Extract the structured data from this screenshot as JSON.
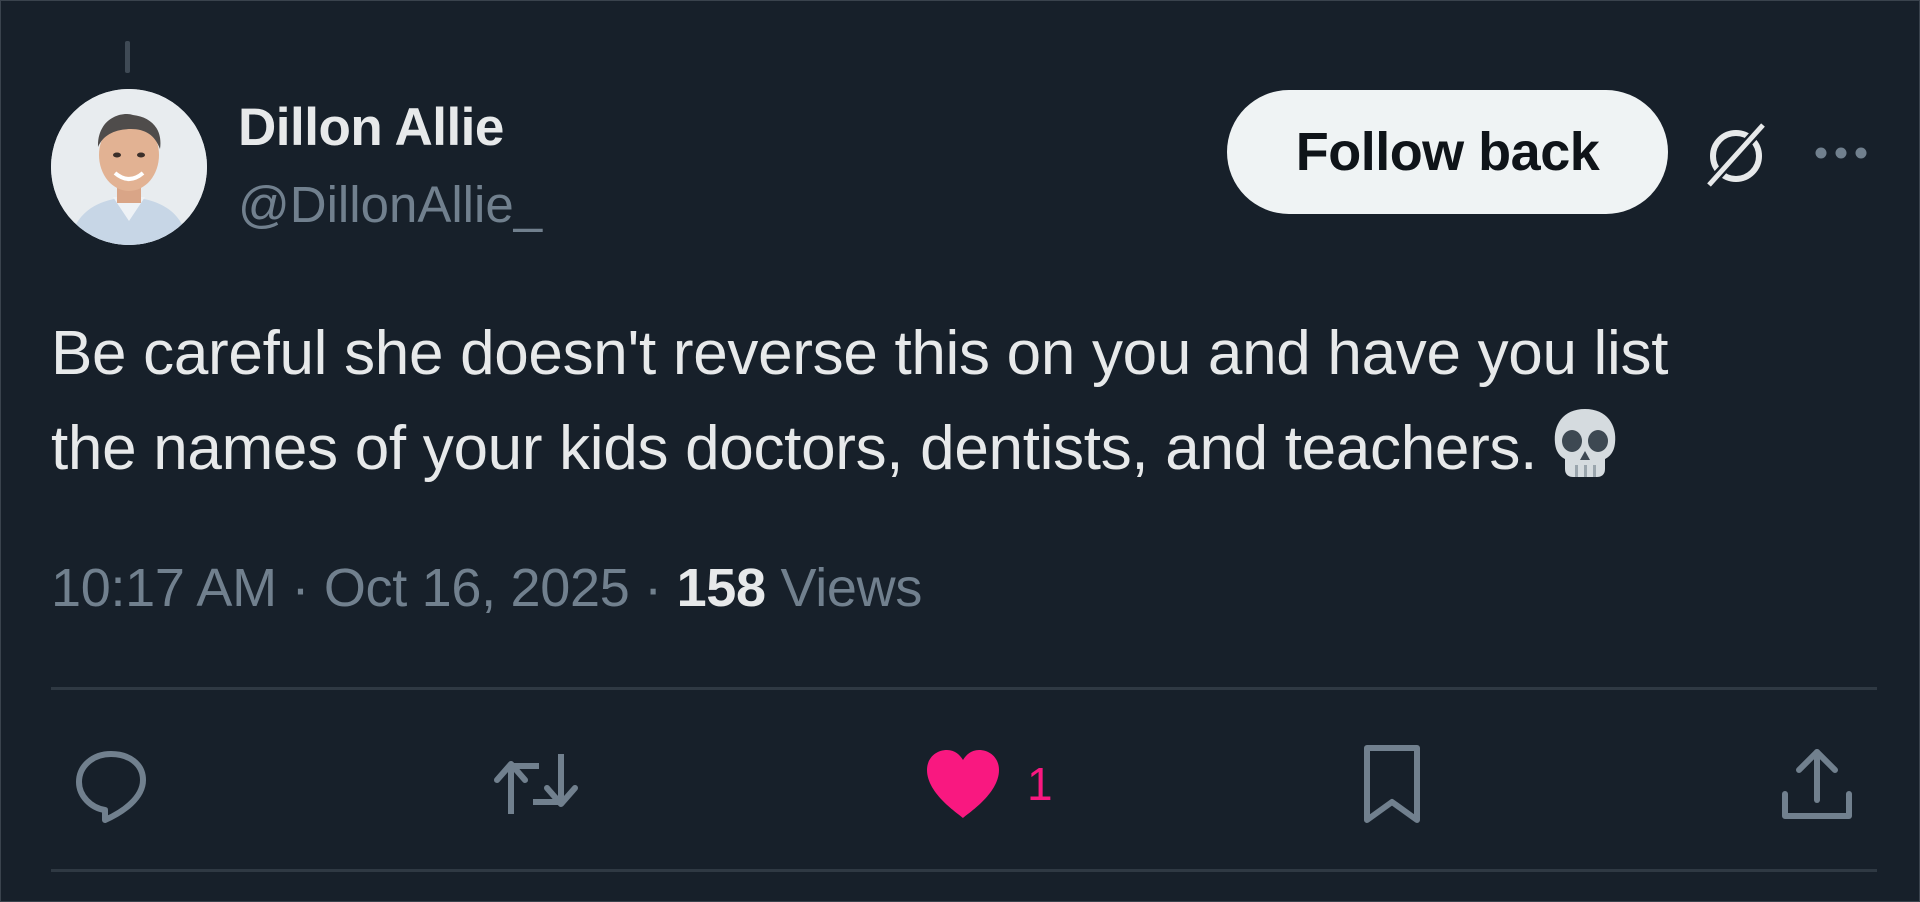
{
  "author": {
    "display_name": "Dillon Allie",
    "handle": "@DillonAllie_"
  },
  "header": {
    "follow_label": "Follow back"
  },
  "tweet": {
    "text_line_1": "Be careful she doesn't reverse this on you and have you list",
    "text_line_2": "the names of your kids doctors, dentists, and teachers.",
    "emoji": "skull-emoji",
    "time": "10:17 AM",
    "separator": "·",
    "date": "Oct 16, 2025",
    "views_count": "158",
    "views_label": "Views"
  },
  "actions": {
    "reply_icon": "reply-icon",
    "retweet_icon": "retweet-icon",
    "like_icon": "heart-icon",
    "like_count": "1",
    "bookmark_icon": "bookmark-icon",
    "share_icon": "share-icon"
  },
  "colors": {
    "background": "#17202a",
    "primary_text": "#e7e9ea",
    "secondary_text": "#71808e",
    "like_pink": "#f91880",
    "button_bg": "#eff3f4"
  }
}
